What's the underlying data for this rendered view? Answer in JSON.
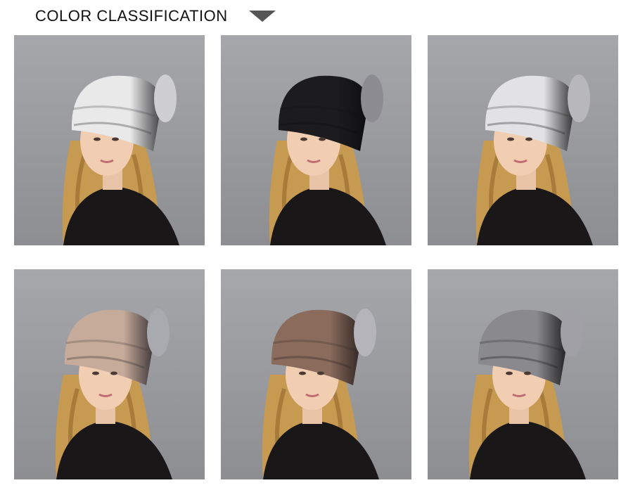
{
  "header": {
    "title": "COLOR CLASSIFICATION",
    "dropdown_icon": "triangle-down-icon"
  },
  "colors": {
    "background": "#ffffff",
    "photo_backdrop": "#9a9b9f"
  },
  "variants": [
    {
      "hat_main": "#e9e9ea",
      "hat_accent": "#3c3c3e",
      "pom": "#cfcfd2"
    },
    {
      "hat_main": "#1c1c1e",
      "hat_accent": "#0e0e10",
      "pom": "#8c8c92"
    },
    {
      "hat_main": "#e2e2e4",
      "hat_accent": "#2a2a2c",
      "pom": "#b8b8bc"
    },
    {
      "hat_main": "#c7ab9a",
      "hat_accent": "#3a3436",
      "pom": "#a9a9b0"
    },
    {
      "hat_main": "#8a6b5c",
      "hat_accent": "#2e2624",
      "pom": "#b4b4ba"
    },
    {
      "hat_main": "#8a8a8e",
      "hat_accent": "#1e1e20",
      "pom": "#a0a0a6"
    }
  ]
}
